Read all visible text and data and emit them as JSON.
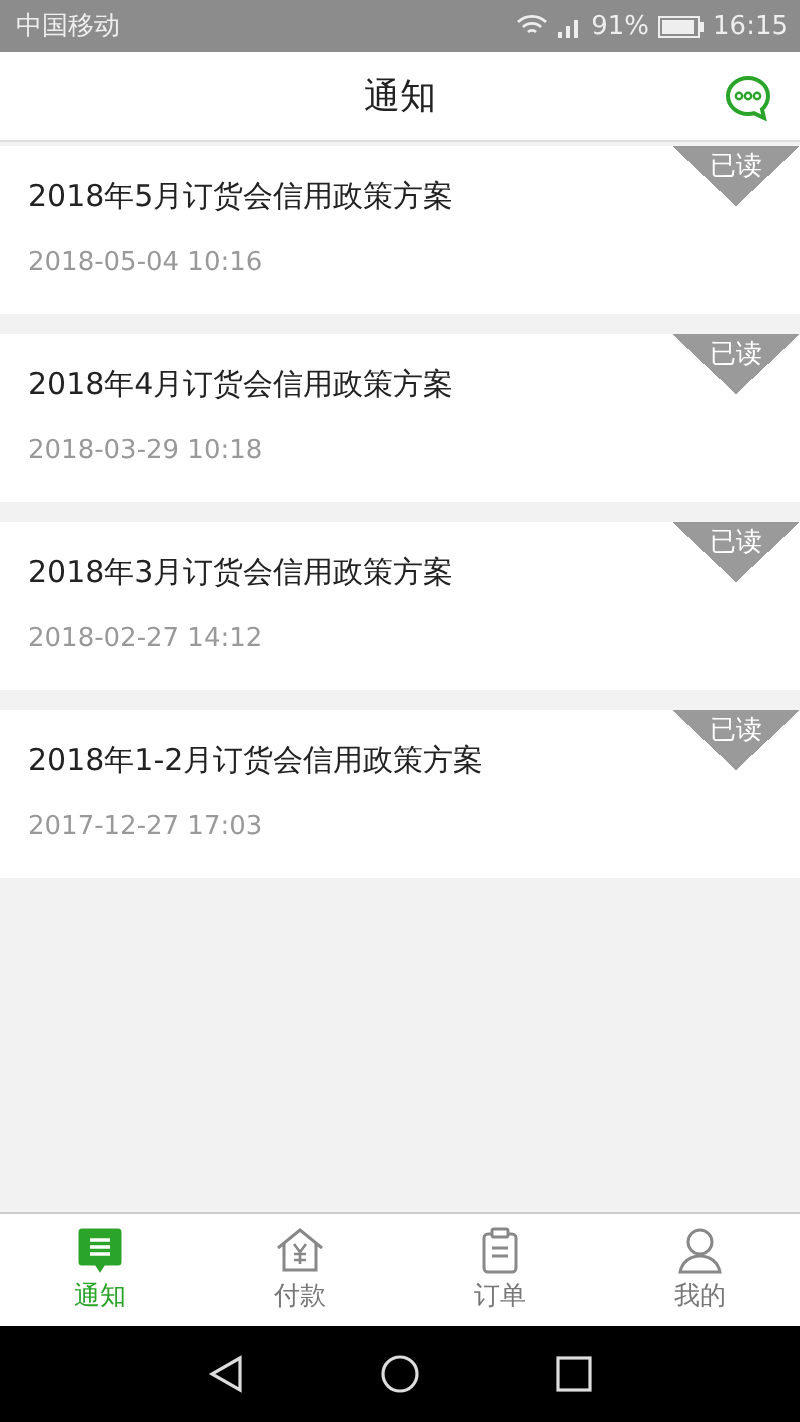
{
  "status_bar": {
    "carrier": "中国移动",
    "battery": "91%",
    "time": "16:15"
  },
  "header": {
    "title": "通知"
  },
  "notices": [
    {
      "title": "2018年5月订货会信用政策方案",
      "date": "2018-05-04 10:16",
      "badge": "已读"
    },
    {
      "title": "2018年4月订货会信用政策方案",
      "date": "2018-03-29 10:18",
      "badge": "已读"
    },
    {
      "title": "2018年3月订货会信用政策方案",
      "date": "2018-02-27 14:12",
      "badge": "已读"
    },
    {
      "title": "2018年1-2月订货会信用政策方案",
      "date": "2017-12-27 17:03",
      "badge": "已读"
    }
  ],
  "tabs": [
    {
      "label": "通知",
      "kind": "notice",
      "selected": true
    },
    {
      "label": "付款",
      "kind": "pay",
      "selected": false
    },
    {
      "label": "订单",
      "kind": "order",
      "selected": false
    },
    {
      "label": "我的",
      "kind": "me",
      "selected": false
    }
  ]
}
